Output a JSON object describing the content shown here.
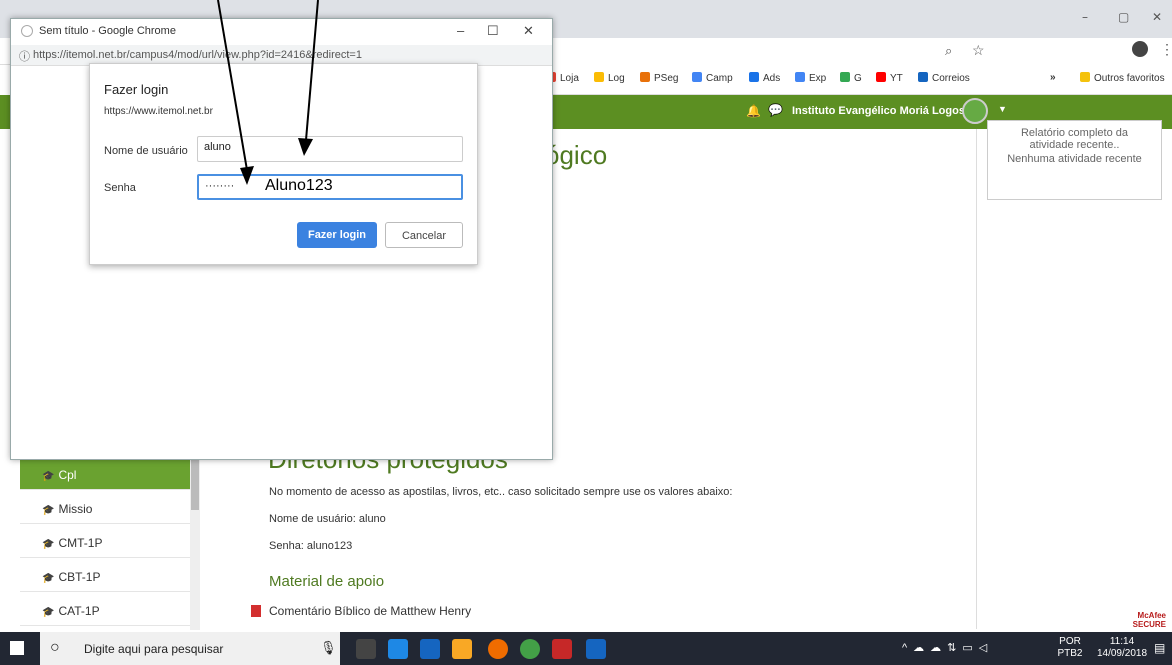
{
  "background_browser": {
    "window_controls": [
      "–",
      "▢",
      "✕"
    ],
    "bookmarks": [
      {
        "label": "Loja",
        "color": "#ea4335"
      },
      {
        "label": "Log",
        "color": "#fbbc05"
      },
      {
        "label": "PSeg",
        "color": "#e8710a"
      },
      {
        "label": "Camp",
        "color": "#4285f4"
      },
      {
        "label": "Ads",
        "color": "#1a73e8"
      },
      {
        "label": "Exp",
        "color": "#4285f4"
      },
      {
        "label": "G",
        "color": "#34a853"
      },
      {
        "label": "YT",
        "color": "#ff0000"
      },
      {
        "label": "Correios",
        "color": "#1565c0"
      }
    ],
    "more": "»",
    "other_favorites": "Outros favoritos"
  },
  "site": {
    "institute": "Instituto Evangélico Moriá Logos IV",
    "right_block": {
      "line1": "Relatório completo da atividade recente..",
      "line2": "Nenhuma atividade recente"
    },
    "heading_partial": "ógico",
    "heading_protected": "Diretórios protegidos",
    "notice": "No momento de acesso as apostilas, livros, etc.. caso solicitado sempre use os valores abaixo:",
    "username_line": "Nome de usuário: aluno",
    "password_line": "Senha: aluno123",
    "support_heading": "Material de apoio",
    "support_item": "Comentário Bíblico de Matthew Henry",
    "mcafee": "McAfee SECURE",
    "courses": [
      "Cpl",
      "Missio",
      "CMT-1P",
      "CBT-1P",
      "CAT-1P"
    ]
  },
  "popup": {
    "title": "Sem título - Google Chrome",
    "url": "https://itemol.net.br/campus4/mod/url/view.php?id=2416&redirect=1",
    "controls": [
      "–",
      "☐",
      "✕"
    ]
  },
  "login": {
    "title": "Fazer login",
    "site": "https://www.itemol.net.br",
    "username_label": "Nome de usuário",
    "username_value": "aluno",
    "password_label": "Senha",
    "password_mask": "········",
    "annotation": "Aluno123",
    "login_button": "Fazer login",
    "cancel_button": "Cancelar"
  },
  "taskbar": {
    "search_placeholder": "Digite aqui para pesquisar",
    "lang_top": "POR",
    "lang_bottom": "PTB2",
    "time": "11:14",
    "date": "14/09/2018"
  }
}
